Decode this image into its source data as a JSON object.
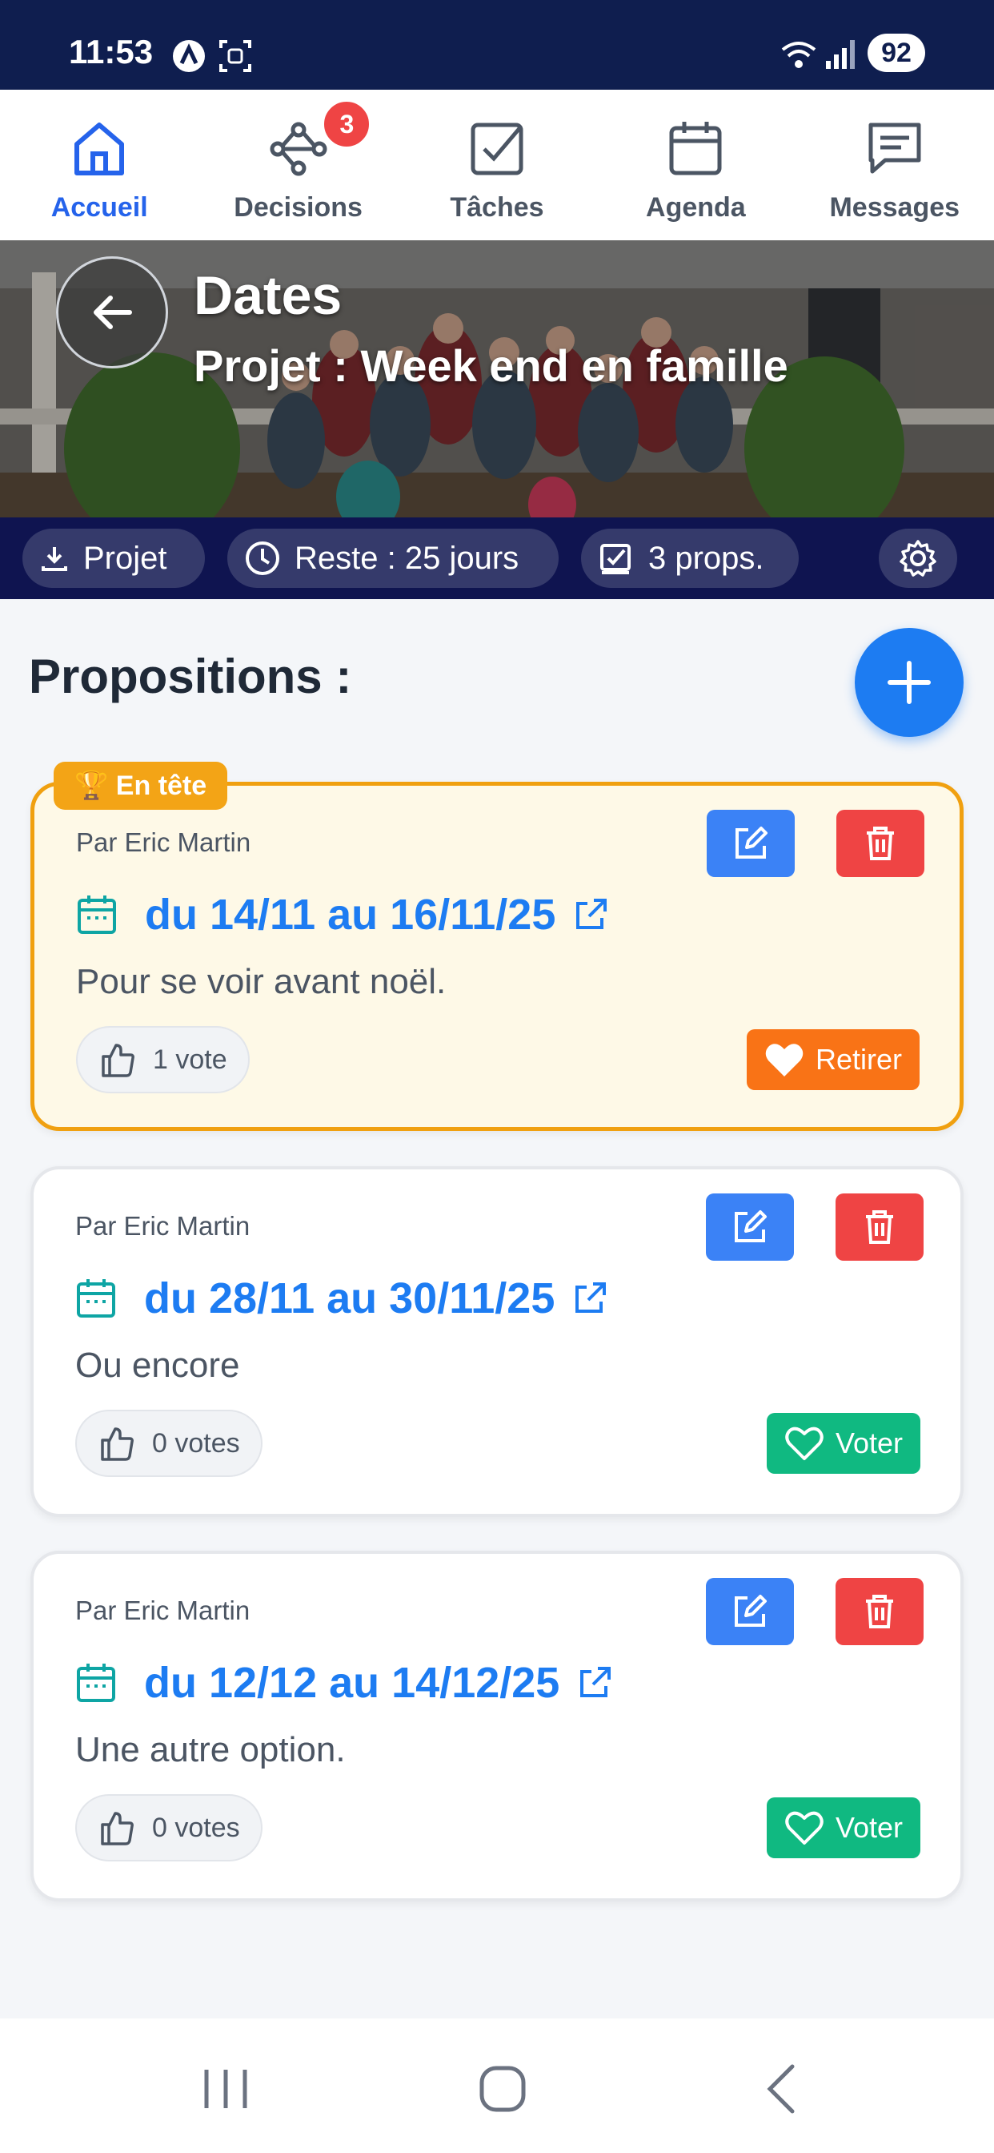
{
  "status": {
    "time": "11:53",
    "battery": "92"
  },
  "nav": {
    "items": [
      {
        "label": "Accueil",
        "icon": "home-icon",
        "active": true
      },
      {
        "label": "Decisions",
        "icon": "decision-tree-icon",
        "badge": "3"
      },
      {
        "label": "Tâches",
        "icon": "task-check-icon"
      },
      {
        "label": "Agenda",
        "icon": "calendar-icon"
      },
      {
        "label": "Messages",
        "icon": "message-icon"
      }
    ]
  },
  "header": {
    "title": "Dates",
    "subtitle": "Projet : Week end en famille"
  },
  "infobar": {
    "project": "Projet",
    "remaining": "Reste : 25 jours",
    "props": "3 props."
  },
  "section_title": "Propositions :",
  "proposals": [
    {
      "leader_tag": "🏆 En tête",
      "author": "Par Eric Martin",
      "dates": "du 14/11 au 16/11/25",
      "description": "Pour se voir avant noël.",
      "votes": "1 vote",
      "action": "Retirer"
    },
    {
      "author": "Par Eric Martin",
      "dates": "du 28/11 au 30/11/25",
      "description": "Ou encore",
      "votes": "0 votes",
      "action": "Voter"
    },
    {
      "author": "Par Eric Martin",
      "dates": "du 12/12 au 14/12/25",
      "description": "Une autre option.",
      "votes": "0 votes",
      "action": "Voter"
    }
  ],
  "colors": {
    "accent": "#1d7cf2",
    "header_bg": "#0f1450",
    "leader": "#f3a416",
    "delete": "#ef4444",
    "vote": "#10b981",
    "retire": "#f97316"
  }
}
